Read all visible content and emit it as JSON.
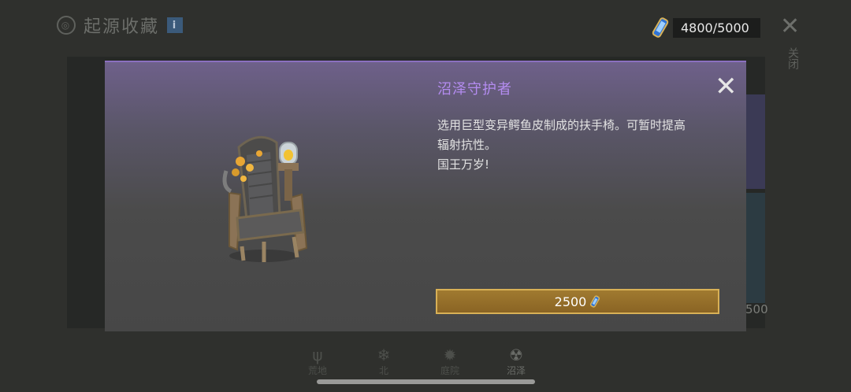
{
  "header": {
    "title": "起源收藏",
    "info_label": "i"
  },
  "currency": {
    "value": "4800/5000",
    "icon": "scroll-icon"
  },
  "close": {
    "label": "关闭"
  },
  "item": {
    "title": "沼泽守护者",
    "description_lines": [
      "选用巨型变异鳄鱼皮制成的扶手椅。可暂时提高",
      "辐射抗性。",
      "国王万岁!"
    ],
    "price": "2500",
    "price_icon": "scroll-icon"
  },
  "background": {
    "side_price": "500"
  },
  "tabs": [
    {
      "label": "荒地",
      "icon": "grass-icon"
    },
    {
      "label": "北",
      "icon": "snowflake-icon"
    },
    {
      "label": "庭院",
      "icon": "sun-icon"
    },
    {
      "label": "沼泽",
      "icon": "radiation-icon"
    }
  ],
  "colors": {
    "title_accent": "#b48cf0",
    "button_fill": "#8a6424",
    "button_border": "#d8b056"
  }
}
